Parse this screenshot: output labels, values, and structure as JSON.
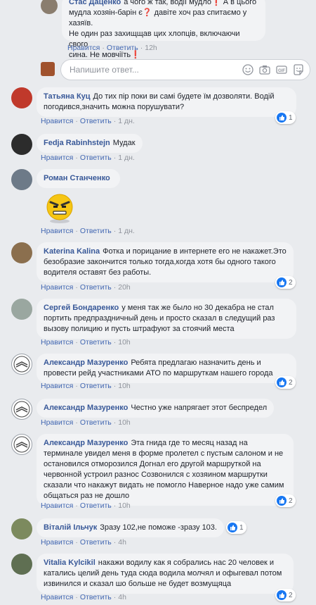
{
  "top_comment": {
    "author": "Стас Даценко",
    "text_line1": "а чого ж так, водії мудло❗ А в цього",
    "text_line2": "мудла хозяін-барін є❓ давіте хоч раз спитаємо у хазяїв.",
    "text_line3": "Не один раз захищщав цих хлопців, включаючи свого",
    "text_line4": "сина. Не мовчіїть❗",
    "like": "Нравится",
    "reply": "Ответить",
    "time": "12h"
  },
  "reply_box": {
    "placeholder": "Напишите ответ..."
  },
  "comments": [
    {
      "author": "Татьяна Куц",
      "text": "До тих пір поки ви самі будете їм дозволяти. Водій погодився,значить можна порушувати?",
      "like": "Нравится",
      "reply": "Ответить",
      "time": "1 дн.",
      "reactions": "1"
    },
    {
      "author": "Fedja Rabinhstejn",
      "text": "Мудак",
      "like": "Нравится",
      "reply": "Ответить",
      "time": "1 дн."
    },
    {
      "author": "Роман Станченко",
      "text": "",
      "like": "Нравится",
      "reply": "Ответить",
      "time": "1 дн."
    },
    {
      "author": "Katerina Kalina",
      "text": "Фотка и порицание в интернете его не накажет.Это безобразие закончится только тогда,когда хотя бы одного такого водителя оставят без работы.",
      "like": "Нравится",
      "reply": "Ответить",
      "time": "20h",
      "reactions": "2"
    },
    {
      "author": "Сергей Бондаренко",
      "text": "у меня так же было но 30 декабра не стал портить предпраздничный день и просто сказал в следущий раз вызову полицию и пусть штрафуют за стоячий места",
      "like": "Нравится",
      "reply": "Ответить",
      "time": "10h"
    },
    {
      "author": "Александр Мазуренко",
      "text": "Ребята предлагаю назначить день и провести рейд участниками АТО по маршруткам нашего города",
      "like": "Нравится",
      "reply": "Ответить",
      "time": "10h",
      "reactions": "2"
    },
    {
      "author": "Александр Мазуренко",
      "text": "Честно уже напрягает этот беспредел",
      "like": "Нравится",
      "reply": "Ответить",
      "time": "10h"
    },
    {
      "author": "Александр Мазуренко",
      "text": "Эта гнида где то месяц назад на терминале увидел меня в форме пролетел с пустым салоном и не остановился отморозился Догнал его другой маршруткой на червонной устроил разнос Созвонился с хозяином маршрутки сказали что накажут видать не помогло Наверное надо уже самим общаться раз не дошло",
      "like": "Нравится",
      "reply": "Ответить",
      "time": "10h",
      "reactions": "2"
    },
    {
      "author": "Віталій Ільчук",
      "text": "Зразу 102,не поможе -зразу 103.",
      "like": "Нравится",
      "reply": "Ответить",
      "time": "4h",
      "reactions": "1"
    },
    {
      "author": "Vitalia Kylcikil",
      "text": "накажи водилу как я собрались нас 20 человек и катались целий день туда сюда водила молчял и офыгевал потом извинился и сказал шо больше не будет возмущяца",
      "like": "Нравится",
      "reply": "Ответить",
      "time": "4h",
      "reactions": "2"
    }
  ],
  "icons": {
    "emoji": "emoji-icon",
    "camera": "camera-icon",
    "gif": "gif-icon",
    "sticker": "sticker-icon",
    "like": "like-icon"
  },
  "colors": {
    "author": "#385898",
    "link": "#4267b2",
    "bubble": "#f2f3f5",
    "like_blue": "#1877f2"
  }
}
